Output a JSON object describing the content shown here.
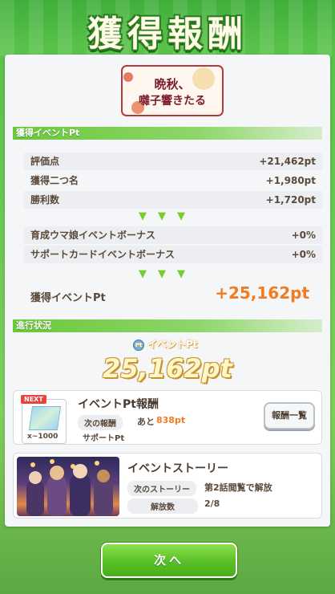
{
  "title": "獲得報酬",
  "event_logo_text": "晩秋、囃子響きたる",
  "earned_section": {
    "header": "獲得イベントPt",
    "rows": [
      {
        "label": "評価点",
        "value": "+21,462pt"
      },
      {
        "label": "獲得二つ名",
        "value": "+1,980pt"
      },
      {
        "label": "勝利数",
        "value": "+1,720pt"
      }
    ],
    "bonus_rows": [
      {
        "label": "育成ウマ娘イベントボーナス",
        "value": "+0%"
      },
      {
        "label": "サポートカードイベントボーナス",
        "value": "+0%"
      }
    ],
    "triangles": "▼▼▼",
    "total_label": "獲得イベントPt",
    "total_value": "+25,162pt"
  },
  "progress_section": {
    "header": "進行状況",
    "pt_label": "イベントPt",
    "pt_icon": "Pt",
    "pt_value": "25,162pt"
  },
  "reward_card": {
    "badge": "NEXT",
    "qty": "x~1000",
    "title": "イベントPt報酬",
    "next_reward_tag": "次の報酬",
    "remaining_prefix": "あと",
    "remaining_value": "838pt",
    "reward_name": "サポートPt",
    "list_button": "報酬一覧"
  },
  "story_card": {
    "title": "イベントストーリー",
    "next_story_tag": "次のストーリー",
    "next_story_value": "第2話閲覧で解放",
    "unlocked_tag": "解放数",
    "unlocked_value": "2/8"
  },
  "next_button": "次へ"
}
